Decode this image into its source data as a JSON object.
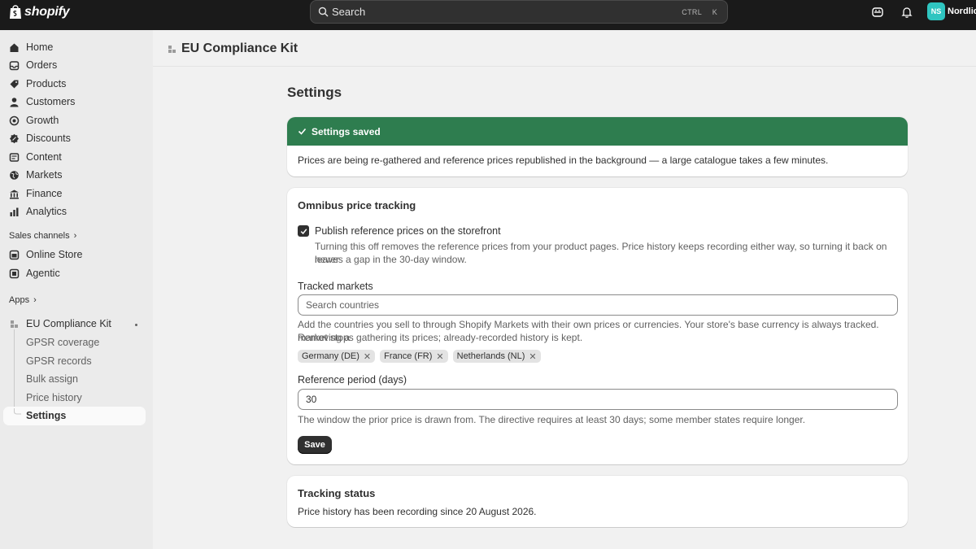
{
  "topbar": {
    "brand": "shopify",
    "search_placeholder": "Search",
    "shortcut_ctrl": "CTRL",
    "shortcut_k": "K",
    "avatar_initials": "NS",
    "store_name": "Nordlicht"
  },
  "sidebar": {
    "items": [
      {
        "label": "Home",
        "icon": "home-icon"
      },
      {
        "label": "Orders",
        "icon": "inbox-icon"
      },
      {
        "label": "Products",
        "icon": "tag-icon"
      },
      {
        "label": "Customers",
        "icon": "person-icon"
      },
      {
        "label": "Growth",
        "icon": "target-icon"
      },
      {
        "label": "Discounts",
        "icon": "discount-icon"
      },
      {
        "label": "Content",
        "icon": "content-icon"
      },
      {
        "label": "Markets",
        "icon": "globe-icon"
      },
      {
        "label": "Finance",
        "icon": "bank-icon"
      },
      {
        "label": "Analytics",
        "icon": "chart-icon"
      }
    ],
    "sales_channels_label": "Sales channels",
    "channels": [
      {
        "label": "Online Store",
        "icon": "store-icon"
      },
      {
        "label": "Agentic",
        "icon": "agent-icon"
      }
    ],
    "apps_label": "Apps",
    "app_name": "EU Compliance Kit",
    "app_subitems": [
      "GPSR coverage",
      "GPSR records",
      "Bulk assign",
      "Price history"
    ],
    "active_subitem": "Settings"
  },
  "main": {
    "app_title": "EU Compliance Kit",
    "page_title": "Settings",
    "banner": {
      "title": "Settings saved",
      "message": "Prices are being re-gathered and reference prices republished in the background — a large catalogue takes a few minutes.",
      "color": "#2e7d4f"
    },
    "omnibus": {
      "title": "Omnibus price tracking",
      "checkbox_label": "Publish reference prices on the storefront",
      "checkbox_checked": true,
      "checkbox_help_1": "Turning this off removes the reference prices from your product pages. Price history keeps recording either way, so turning it back on never",
      "checkbox_help_2": "leaves a gap in the 30-day window.",
      "markets_label": "Tracked markets",
      "markets_placeholder": "Search countries",
      "markets_help_1": "Add the countries you sell to through Shopify Markets with their own prices or currencies. Your store's base currency is always tracked. Removing a",
      "markets_help_2": "market stops gathering its prices; already-recorded history is kept.",
      "markets_tags": [
        "Germany (DE)",
        "France (FR)",
        "Netherlands (NL)"
      ],
      "period_label": "Reference period (days)",
      "period_value": "30",
      "period_help": "The window the prior price is drawn from. The directive requires at least 30 days; some member states require longer.",
      "save_label": "Save"
    },
    "status": {
      "title": "Tracking status",
      "text": "Price history has been recording since 20 August 2026."
    }
  }
}
